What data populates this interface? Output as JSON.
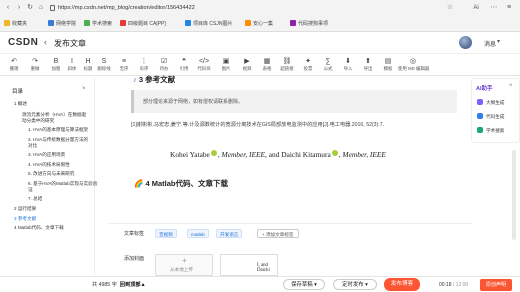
{
  "browser": {
    "url": "https://mp.csdn.net/mp_blog/creation/editor/156434422",
    "bookmarks": [
      "收藏夹",
      "网络学院",
      "学术搜索",
      "四级题目 CA[PP]",
      "项目库 CSJN图片",
      "安心一集",
      "代码搜狗事项"
    ],
    "colors": {
      "bookmark_icons": [
        "#f0b429",
        "#3a7bd5",
        "#4caf50",
        "#e53935",
        "#1e88e5",
        "#fb8c00",
        "#8e24aa"
      ]
    }
  },
  "header": {
    "logo": "CSDN",
    "back_icon": "chevron-left-icon",
    "title": "发布文章",
    "draft_label": "消息",
    "caret": "▾"
  },
  "toolbar": {
    "items": [
      {
        "glyph": "↶",
        "label": "撤销"
      },
      {
        "glyph": "↷",
        "label": "重做"
      },
      {
        "glyph": "B",
        "label": "加粗"
      },
      {
        "glyph": "I",
        "label": "斜体"
      },
      {
        "glyph": "H",
        "label": "标题"
      },
      {
        "glyph": "S",
        "label": "删除线"
      },
      {
        "glyph": "≡",
        "label": "无序"
      },
      {
        "glyph": "⋮",
        "label": "有序"
      },
      {
        "glyph": "☑",
        "label": "待办"
      },
      {
        "glyph": "❝",
        "label": "引用"
      },
      {
        "glyph": "</>",
        "label": "代码块"
      },
      {
        "glyph": "▣",
        "label": "图片"
      },
      {
        "glyph": "▶",
        "label": "视频"
      },
      {
        "glyph": "▦",
        "label": "表格"
      },
      {
        "glyph": "⛓",
        "label": "超链接"
      },
      {
        "glyph": "✦",
        "label": "投票"
      },
      {
        "glyph": "∑",
        "label": "公式"
      },
      {
        "glyph": "⬇",
        "label": "导入"
      },
      {
        "glyph": "⬆",
        "label": "导出"
      },
      {
        "glyph": "▤",
        "label": "模板"
      },
      {
        "glyph": "◎",
        "label": "使用 MD 编辑器"
      }
    ]
  },
  "sidebar": {
    "title": "目录",
    "close_icon": "×",
    "items": [
      {
        "text": "1 概述",
        "level": 0,
        "active": false
      },
      {
        "text": "源流元素分析（HVA）在数据驱",
        "level": 1,
        "active": false
      },
      {
        "text": "动分类中的研究",
        "level": 1,
        "active": false
      },
      {
        "text": "1. HVA的基本原理与算法框架",
        "level": 2,
        "active": false
      },
      {
        "text": "2. HVA与传统数据分量方法的",
        "level": 2,
        "active": false
      },
      {
        "text": "对比",
        "level": 2,
        "active": false
      },
      {
        "text": "3. HVA的应用场景",
        "level": 2,
        "active": false
      },
      {
        "text": "4. HVA的技术局限性",
        "level": 2,
        "active": false
      },
      {
        "text": "5. 改进方向与未来研究",
        "level": 2,
        "active": false
      },
      {
        "text": "6. 基于HVA的Matlab实现与实验验",
        "level": 2,
        "active": false
      },
      {
        "text": "证",
        "level": 2,
        "active": false
      },
      {
        "text": "7. 总结",
        "level": 2,
        "active": false
      },
      {
        "text": "2 运行结果",
        "level": 0,
        "active": false
      },
      {
        "text": "3 参考文献",
        "level": 0,
        "active": true
      },
      {
        "text": "4 Matlab代码、文章下载",
        "level": 0,
        "active": false
      }
    ]
  },
  "content": {
    "h3": "3 参考文献",
    "quote": "部分理论来源于网络，如有侵权请联系删除。",
    "ref1": "[1]谢彬彬,马宏忠,姜宁.等.计及源数统计的宽源分离技术在GIS局部放电监测中的应用[J].电工电器.2016, 52(3):7.",
    "authors_plain1": "Kohei Yatabe",
    "authors_ital1": "Member, IEEE",
    "authors_plain2": ", and Daichi Kitamura",
    "authors_ital2": "Member, IEEE",
    "h4": "4 Matlab代码、文章下载"
  },
  "settings": {
    "tag_label": "文章标签",
    "tags": [
      "音视频",
      "matlab",
      "开发语言"
    ],
    "add_tag": "+ 添加文章标签",
    "cover_label": "添加封面",
    "cover_add": "从本地上传",
    "cover_img_text": "I, and Daichi"
  },
  "right_panel": {
    "title": "AI助手",
    "close": "×",
    "items": [
      {
        "label": "大纲生成",
        "color": "#7b61ff"
      },
      {
        "label": "代码生成",
        "color": "#2f80ed"
      },
      {
        "label": "学术搜索",
        "color": "#19a974"
      }
    ]
  },
  "bottom": {
    "count_prefix": "共",
    "count_value": "4985",
    "count_suffix": "字",
    "back_to_top": "回到顶部▲",
    "save_draft": "保存草稿",
    "save_draft_caret": "▾",
    "schedule": "定时发布",
    "schedule_caret": "▾",
    "publish": "发布博客",
    "timer_value": "00:18",
    "timer_total": "/ 12:00",
    "red_button": "原创声明"
  }
}
